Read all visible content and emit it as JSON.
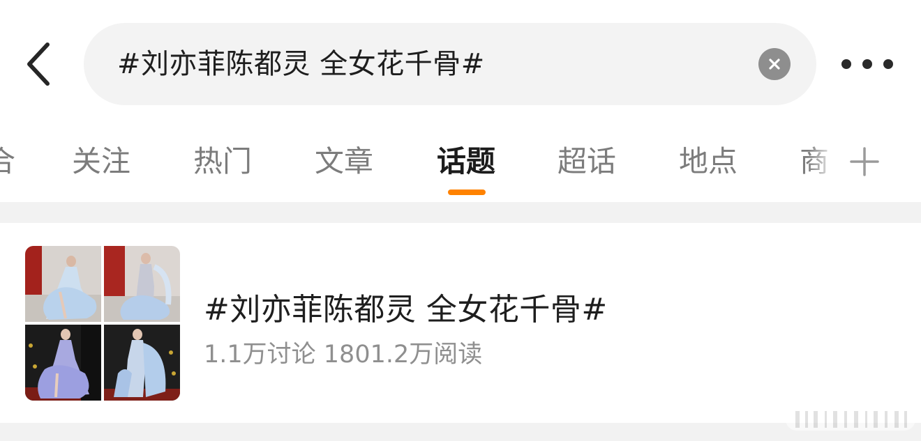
{
  "search": {
    "query": "#刘亦菲陈都灵 全女花千骨#"
  },
  "tabs": [
    {
      "label": "综合"
    },
    {
      "label": "关注"
    },
    {
      "label": "热门"
    },
    {
      "label": "文章"
    },
    {
      "label": "话题"
    },
    {
      "label": "超话"
    },
    {
      "label": "地点"
    },
    {
      "label": "商品"
    }
  ],
  "active_tab": "话题",
  "topic": {
    "title": "#刘亦菲陈都灵 全女花千骨#",
    "stats": "1.1万讨论 1801.2万阅读",
    "thumbnails": [
      {
        "scene": "red-curtain-dress-photo"
      },
      {
        "scene": "red-curtain-dress-photo"
      },
      {
        "scene": "dark-backdrop-dress-photo"
      },
      {
        "scene": "dark-backdrop-dress-photo"
      }
    ]
  },
  "icons": {
    "back": "chevron-left-icon",
    "clear": "clear-x-icon",
    "more": "more-dots-icon",
    "add_tab": "plus-icon"
  },
  "colors": {
    "accent": "#ff8200",
    "search_bg": "#f3f3f3",
    "divider": "#f2f2f2",
    "muted_text": "#8f8f8f",
    "tab_inactive": "#7c7c7c"
  }
}
